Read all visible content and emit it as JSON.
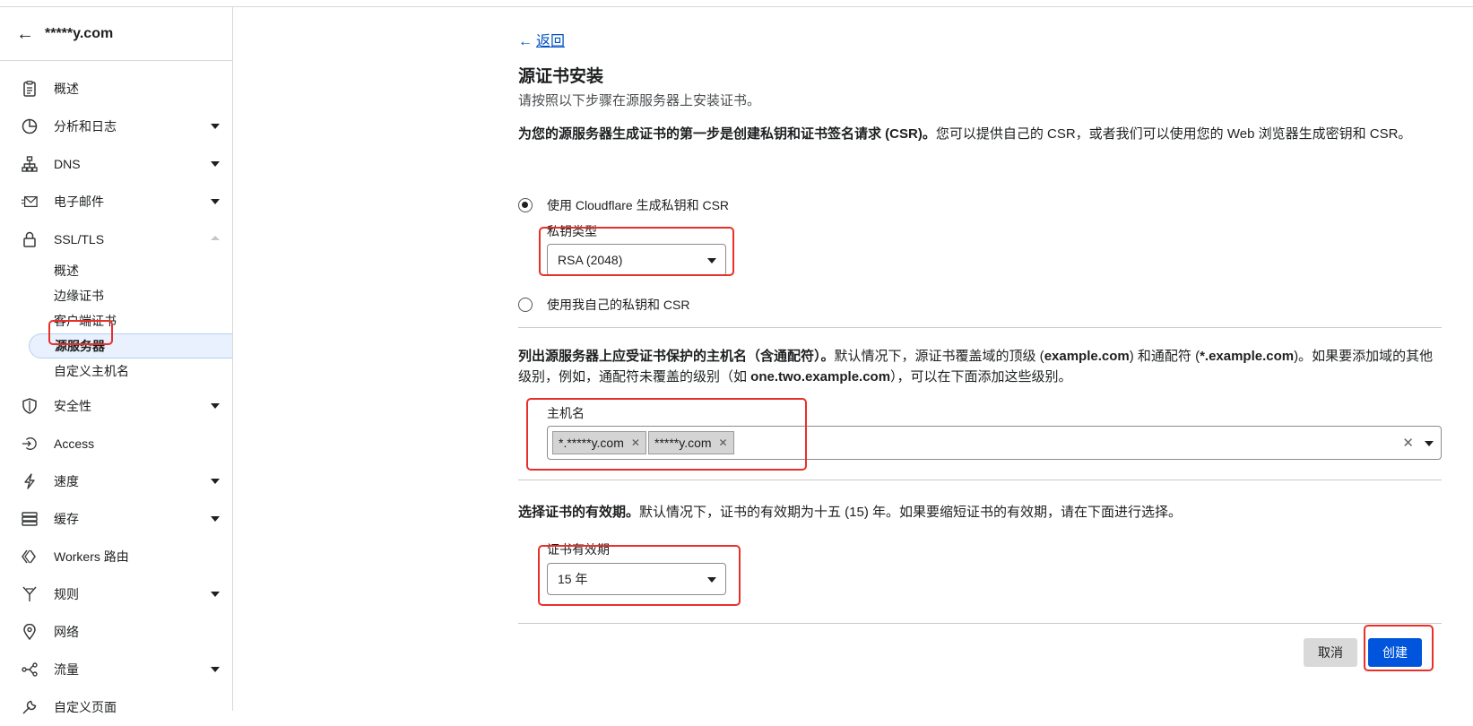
{
  "sidebar": {
    "domain": "*****y.com",
    "items": [
      {
        "label": "概述",
        "icon": "clipboard-icon"
      },
      {
        "label": "分析和日志",
        "icon": "chart-icon"
      },
      {
        "label": "DNS",
        "icon": "network-icon"
      },
      {
        "label": "电子邮件",
        "icon": "email-icon"
      },
      {
        "label": "SSL/TLS",
        "icon": "lock-icon"
      },
      {
        "label": "安全性",
        "icon": "shield-icon"
      },
      {
        "label": "Access",
        "icon": "access-icon"
      },
      {
        "label": "速度",
        "icon": "lightning-icon"
      },
      {
        "label": "缓存",
        "icon": "storage-icon"
      },
      {
        "label": "Workers 路由",
        "icon": "workers-icon"
      },
      {
        "label": "规则",
        "icon": "rules-icon"
      },
      {
        "label": "网络",
        "icon": "location-icon"
      },
      {
        "label": "流量",
        "icon": "traffic-icon"
      },
      {
        "label": "自定义页面",
        "icon": "wrench-icon"
      }
    ],
    "ssl_sub": [
      "概述",
      "边缘证书",
      "客户端证书",
      "源服务器",
      "自定义主机名"
    ]
  },
  "main": {
    "back": "返回",
    "title": "源证书安装",
    "subtitle": "请按照以下步骤在源服务器上安装证书。",
    "csr_bold": "为您的源服务器生成证书的第一步是创建私钥和证书签名请求 (CSR)。",
    "csr_rest": "您可以提供自己的 CSR，或者我们可以使用您的 Web 浏览器生成密钥和 CSR。",
    "radio_cloudflare": "使用 Cloudflare 生成私钥和 CSR",
    "key_type_label": "私钥类型",
    "key_type_value": "RSA (2048)",
    "radio_own": "使用我自己的私钥和 CSR",
    "hosts_bold": "列出源服务器上应受证书保护的主机名（含通配符）。",
    "hosts_p1": "默认情况下，源证书覆盖域的顶级 (",
    "hosts_ex1": "example.com",
    "hosts_p2": ") 和通配符 (",
    "hosts_ex2": "*.example.com",
    "hosts_p3": ")。如果要添加域的其他级别，例如，通配符未覆盖的级别（如 ",
    "hosts_ex3": "one.two.example.com",
    "hosts_p4": "），可以在下面添加这些级别。",
    "hostname_label": "主机名",
    "hostnames": [
      "*.*****y.com",
      "*****y.com"
    ],
    "validity_bold": "选择证书的有效期。",
    "validity_rest": "默认情况下，证书的有效期为十五 (15) 年。如果要缩短证书的有效期，请在下面进行选择。",
    "validity_label": "证书有效期",
    "validity_value": "15 年",
    "cancel": "取消",
    "create": "创建"
  }
}
